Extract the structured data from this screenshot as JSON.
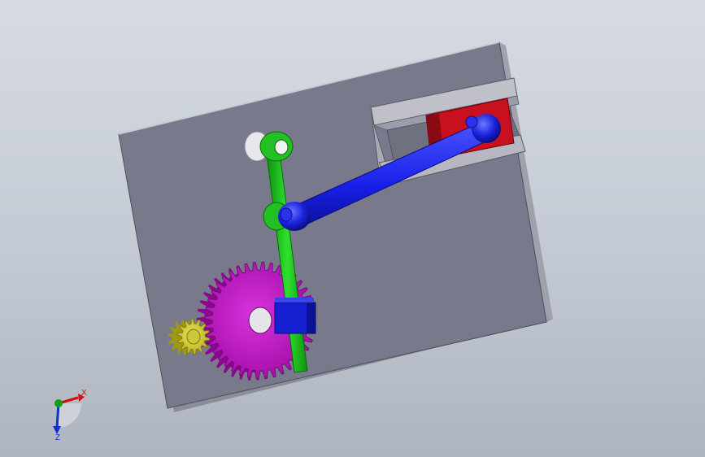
{
  "viewport": {
    "background": "#c9ced6"
  },
  "colors": {
    "plate_face": "#7a7b8d",
    "plate_side": "#a9aab4",
    "slider_guide": "#7f8090",
    "slider_block": "#c8101e",
    "link_blue": "#1820e8",
    "rod_green": "#1bc21b",
    "gear_large": "#c312c8",
    "gear_small": "#d8d020",
    "coupler_blue": "#1520d0"
  },
  "triad": {
    "x_label": "X",
    "z_label": "Z",
    "x_color": "#d01010",
    "y_color": "#10a010",
    "z_color": "#1030d0"
  },
  "parts": {
    "plate": "base-plate",
    "slider": "slider-block",
    "connecting_rod": "blue-connecting-rod",
    "green_rod": "green-rocker-rod",
    "large_gear": "large-gear",
    "small_gear": "small-pinion-gear"
  }
}
